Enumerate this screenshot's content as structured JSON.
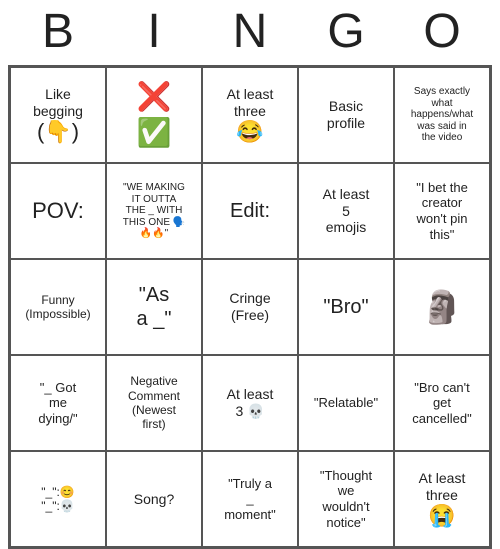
{
  "header": [
    "B",
    "I",
    "N",
    "G",
    "O"
  ],
  "grid": [
    [
      {
        "lines": [
          "Like",
          "begging"
        ],
        "emoji": "(👇)"
      },
      {
        "emojis": [
          "❌",
          "✅"
        ]
      },
      {
        "lines": [
          "At least",
          "three"
        ],
        "emoji": "😂"
      },
      {
        "lines": [
          "Basic",
          "profile"
        ]
      },
      {
        "small": true,
        "lines": [
          "Says exactly",
          "what",
          "happens/what",
          "was said in",
          "the video"
        ]
      }
    ],
    [
      {
        "pov": "POV:"
      },
      {
        "small": true,
        "lines": [
          "\"WE MAKING",
          "IT OUTTA",
          "THE _ WITH",
          "THIS ONE 🗣️",
          "🔥🔥\""
        ]
      },
      {
        "lg": true,
        "lines": [
          "Edit:"
        ]
      },
      {
        "lines": [
          "At least",
          "5",
          "emojis"
        ]
      },
      {
        "med": true,
        "lines": [
          "\"I bet the",
          "creator",
          "won't pin",
          "this\""
        ]
      }
    ],
    [
      {
        "lines": [
          "Funny",
          "(Impossible)"
        ],
        "smallish": true
      },
      {
        "lg": true,
        "lines": [
          "\"As",
          "a _\""
        ]
      },
      {
        "lines": [
          "Cringe",
          "(Free)"
        ]
      },
      {
        "lg": true,
        "lines": [
          "\"Bro\""
        ]
      },
      {
        "bigEmoji": "🗿"
      }
    ],
    [
      {
        "med": true,
        "lines": [
          "\"_ Got",
          "me",
          "dying/\""
        ]
      },
      {
        "smallish": true,
        "lines": [
          "Negative",
          "Comment",
          "(Newest",
          "first)"
        ]
      },
      {
        "lines": [
          "At least",
          "3 💀"
        ]
      },
      {
        "med": true,
        "lines": [
          "\"Relatable\""
        ]
      },
      {
        "med": true,
        "lines": [
          "\"Bro can't",
          "get",
          "cancelled\""
        ]
      }
    ],
    [
      {
        "quoteLines": [
          "\"_\":😊",
          "\"_\":💀"
        ]
      },
      {
        "lines": [
          "Song?"
        ]
      },
      {
        "med": true,
        "lines": [
          "\"Truly a",
          "_",
          "moment\""
        ]
      },
      {
        "med": true,
        "lines": [
          "\"Thought",
          "we",
          "wouldn't",
          "notice\""
        ]
      },
      {
        "lines": [
          "At least",
          "three"
        ],
        "emoji": "😭"
      }
    ]
  ]
}
